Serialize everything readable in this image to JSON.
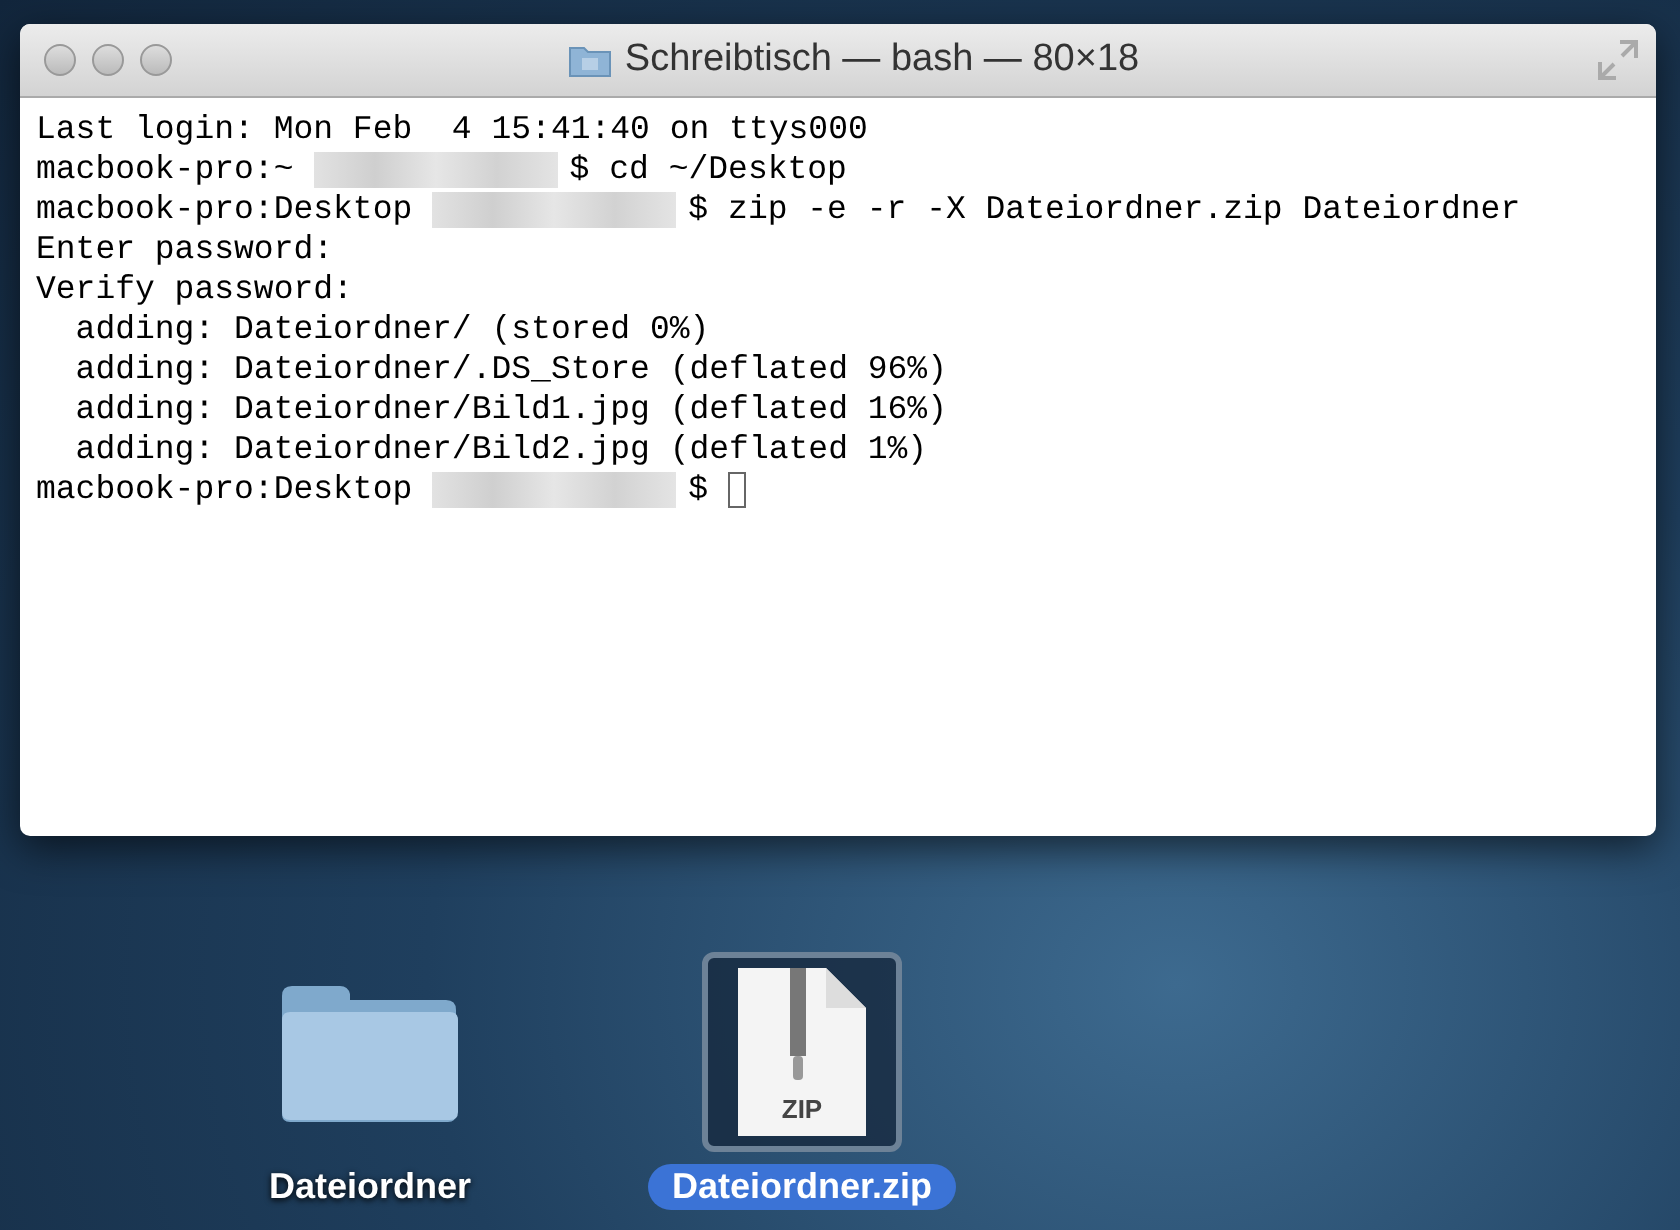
{
  "window": {
    "title": "Schreibtisch — bash — 80×18"
  },
  "terminal": {
    "lines": [
      {
        "kind": "plain",
        "text": "Last login: Mon Feb  4 15:41:40 on ttys000"
      },
      {
        "kind": "prompt",
        "host": "macbook-pro:~",
        "symbol": "$",
        "command": "cd ~/Desktop"
      },
      {
        "kind": "prompt",
        "host": "macbook-pro:Desktop",
        "symbol": "$",
        "command": "zip -e -r -X Dateiordner.zip Dateiordner"
      },
      {
        "kind": "plain",
        "text": "Enter password:"
      },
      {
        "kind": "plain",
        "text": "Verify password:"
      },
      {
        "kind": "plain",
        "text": "  adding: Dateiordner/ (stored 0%)"
      },
      {
        "kind": "plain",
        "text": "  adding: Dateiordner/.DS_Store (deflated 96%)"
      },
      {
        "kind": "plain",
        "text": "  adding: Dateiordner/Bild1.jpg (deflated 16%)"
      },
      {
        "kind": "plain",
        "text": "  adding: Dateiordner/Bild2.jpg (deflated 1%)"
      },
      {
        "kind": "prompt",
        "host": "macbook-pro:Desktop",
        "symbol": "$",
        "cursor": true
      }
    ]
  },
  "desktop_icons": [
    {
      "kind": "folder",
      "label": "Dateiordner",
      "selected": false
    },
    {
      "kind": "zip",
      "label": "Dateiordner.zip",
      "badge": "ZIP",
      "selected": true
    }
  ]
}
